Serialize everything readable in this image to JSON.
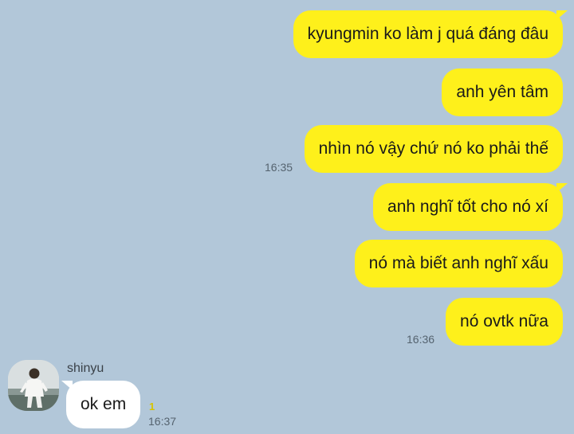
{
  "outgoing": [
    {
      "text": "kyungmin ko làm j quá đáng đâu"
    },
    {
      "text": "anh yên tâm"
    },
    {
      "text": "nhìn nó vậy chứ nó ko phải thế",
      "time": "16:35"
    },
    {
      "text": "anh nghĩ tốt cho nó xí"
    },
    {
      "text": "nó mà biết anh nghĩ xấu"
    },
    {
      "text": "nó ovtk nữa",
      "time": "16:36"
    }
  ],
  "incoming": {
    "sender": "shinyu",
    "text": "ok em",
    "unread_count": "1",
    "time": "16:37"
  },
  "colors": {
    "background": "#b2c7d9",
    "outgoing_bubble": "#fef01b",
    "incoming_bubble": "#ffffff",
    "unread": "#d7c300"
  }
}
